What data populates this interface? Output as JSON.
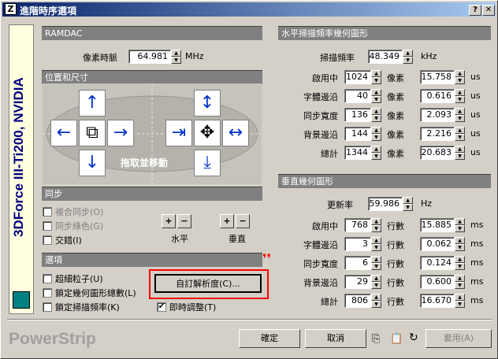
{
  "window": {
    "title": "進階時序選項",
    "help": "?",
    "close": "✕"
  },
  "sidebar": {
    "label": "3DForce III-Ti200, NVIDIA"
  },
  "ramdac": {
    "header": "RAMDAC",
    "pixel_clock_label": "像素時脈",
    "pixel_clock_value": "64.981",
    "unit": "MHz"
  },
  "position": {
    "header": "位置和尺寸",
    "drag_label": "拖取並移動"
  },
  "sync": {
    "header": "同步",
    "composite": "複合同步(O)",
    "green": "同步綠色(G)",
    "interlace": "交錯(I)",
    "horizontal": "水平",
    "vertical": "垂直"
  },
  "options": {
    "header": "選項",
    "ultrafine": "超細粒子(U)",
    "lock_total": "鎖定幾何圖形總數(L)",
    "lock_scan": "鎖定掃描頻率(K)",
    "custom_res": "自訂解析度(C)...",
    "immediate": "即時調整(T)",
    "immediate_checked": true
  },
  "hscan": {
    "header": "水平掃描頻率幾何圖形",
    "freq_label": "掃描頻率",
    "freq_value": "48.349",
    "freq_unit": "kHz",
    "rows": [
      {
        "label": "啟用中",
        "value": "1024",
        "unit": "像素",
        "time": "15.758",
        "tunit": "us"
      },
      {
        "label": "字體邊沿",
        "value": "40",
        "unit": "像素",
        "time": "0.616",
        "tunit": "us"
      },
      {
        "label": "同步寬度",
        "value": "136",
        "unit": "像素",
        "time": "2.093",
        "tunit": "us"
      },
      {
        "label": "背景邊沿",
        "value": "144",
        "unit": "像素",
        "time": "2.216",
        "tunit": "us"
      },
      {
        "label": "總計",
        "value": "1344",
        "unit": "像素",
        "time": "20.683",
        "tunit": "us"
      }
    ]
  },
  "vscan": {
    "header": "垂直幾何圖形",
    "freq_label": "更新率",
    "freq_value": "59.986",
    "freq_unit": "Hz",
    "rows": [
      {
        "label": "啟用中",
        "value": "768",
        "unit": "行數",
        "time": "15.885",
        "tunit": "ms"
      },
      {
        "label": "字體邊沿",
        "value": "3",
        "unit": "行數",
        "time": "0.062",
        "tunit": "ms"
      },
      {
        "label": "同步寬度",
        "value": "6",
        "unit": "行數",
        "time": "0.124",
        "tunit": "ms"
      },
      {
        "label": "背景邊沿",
        "value": "29",
        "unit": "行數",
        "time": "0.600",
        "tunit": "ms"
      },
      {
        "label": "總計",
        "value": "806",
        "unit": "行數",
        "time": "16.670",
        "tunit": "ms"
      }
    ]
  },
  "footer": {
    "brand": "PowerStrip",
    "ok": "確定",
    "cancel": "取消",
    "apply": "套用(A)"
  }
}
